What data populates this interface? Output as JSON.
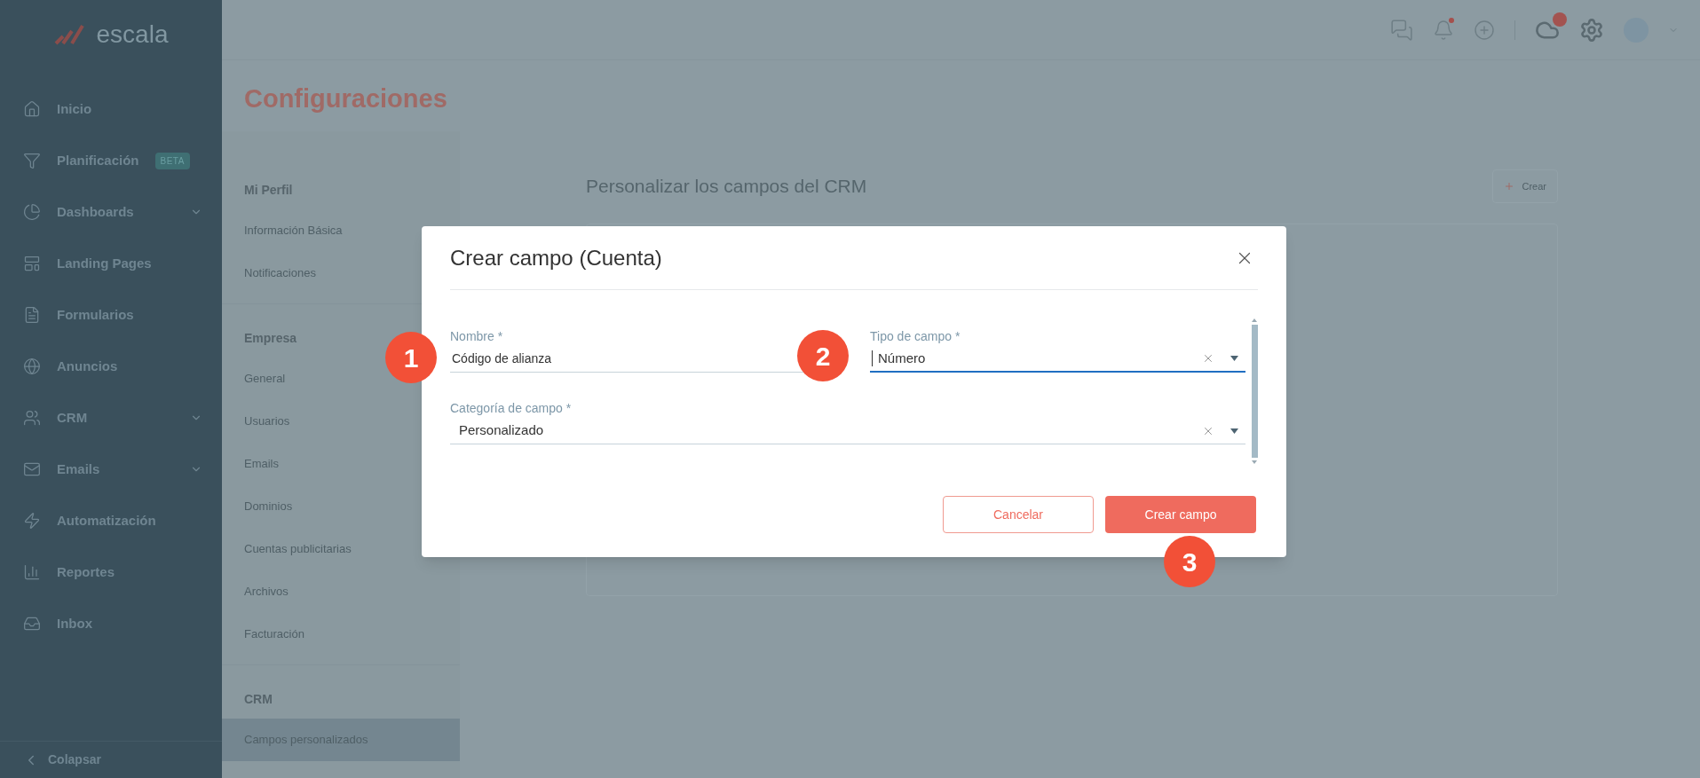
{
  "sidebar": {
    "logo": "escala",
    "items": [
      {
        "label": "Inicio",
        "expandable": false
      },
      {
        "label": "Planificación",
        "badge": "BETA",
        "expandable": false
      },
      {
        "label": "Dashboards",
        "expandable": true
      },
      {
        "label": "Landing Pages",
        "expandable": false
      },
      {
        "label": "Formularios",
        "expandable": false
      },
      {
        "label": "Anuncios",
        "expandable": false
      },
      {
        "label": "CRM",
        "expandable": true
      },
      {
        "label": "Emails",
        "expandable": true
      },
      {
        "label": "Automatización",
        "expandable": false
      },
      {
        "label": "Reportes",
        "expandable": false
      },
      {
        "label": "Inbox",
        "expandable": false
      }
    ],
    "collapse": "Colapsar"
  },
  "page_title": "Configuraciones",
  "settings_menu": [
    {
      "heading": "Mi Perfil",
      "items": [
        {
          "label": "Información Básica",
          "selected": false
        },
        {
          "label": "Notificaciones",
          "selected": false
        }
      ]
    },
    {
      "heading": "Empresa",
      "items": [
        {
          "label": "General",
          "selected": false
        },
        {
          "label": "Usuarios",
          "selected": false
        },
        {
          "label": "Emails",
          "selected": false
        },
        {
          "label": "Dominios",
          "selected": false
        },
        {
          "label": "Cuentas publicitarias",
          "selected": false
        },
        {
          "label": "Archivos",
          "selected": false
        },
        {
          "label": "Facturación",
          "selected": false
        }
      ]
    },
    {
      "heading": "CRM",
      "items": [
        {
          "label": "Campos personalizados",
          "selected": true
        }
      ]
    }
  ],
  "content": {
    "title": "Personalizar los campos del CRM",
    "create_button": "Crear"
  },
  "modal": {
    "title": "Crear campo (Cuenta)",
    "fields": [
      {
        "kind": "text",
        "label": "Nombre *",
        "value": "Código de alianza",
        "focused": false
      },
      {
        "kind": "select",
        "label": "Tipo de campo *",
        "value": "Número",
        "focused": true
      },
      {
        "kind": "select",
        "label": "Categoría de campo *",
        "value": "Personalizado",
        "focused": false
      }
    ],
    "buttons": [
      {
        "label": "Cancelar",
        "kind": "secondary"
      },
      {
        "label": "Crear campo",
        "kind": "primary"
      }
    ]
  },
  "callouts": [
    "1",
    "2",
    "3"
  ]
}
